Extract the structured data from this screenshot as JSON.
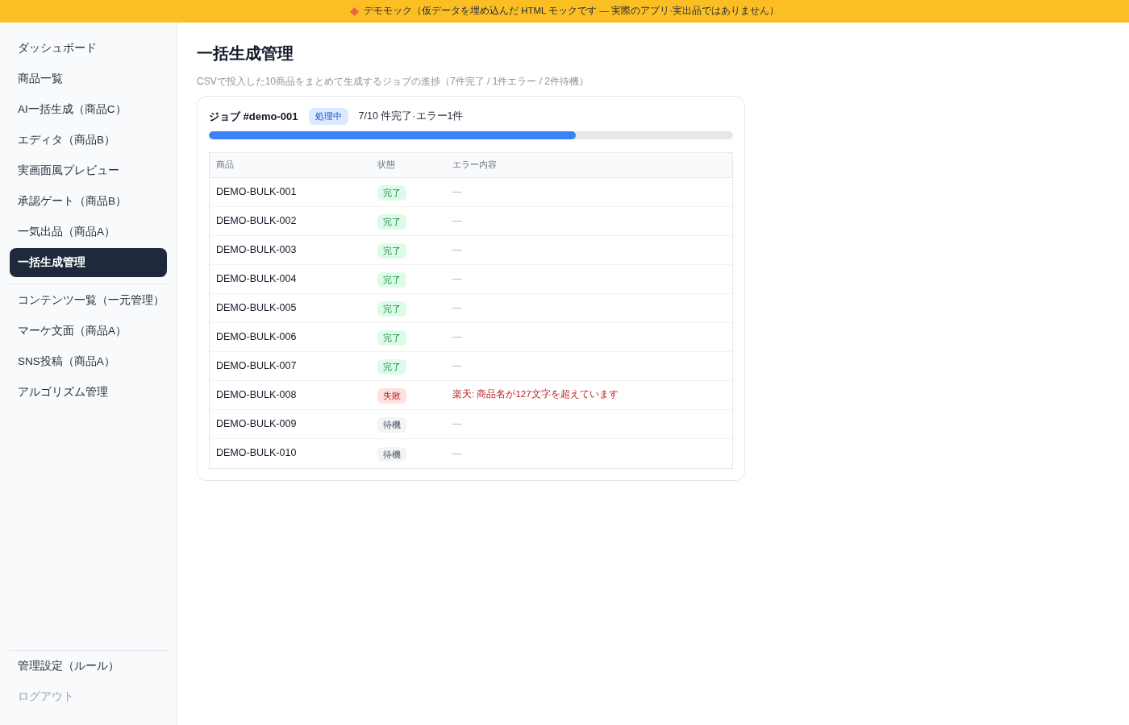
{
  "banner": {
    "text": "デモモック（仮データを埋め込んだ HTML モックです — 実際のアプリ·実出品ではありません）"
  },
  "sidebar": {
    "main_items": [
      {
        "label": "ダッシュボード",
        "selected": false
      },
      {
        "label": "商品一覧",
        "selected": false
      },
      {
        "label": "AI一括生成（商品C）",
        "selected": false
      },
      {
        "label": "エディタ（商品B）",
        "selected": false
      },
      {
        "label": "実画面風プレビュー",
        "selected": false
      },
      {
        "label": "承認ゲート（商品B）",
        "selected": false
      },
      {
        "label": "一気出品（商品A）",
        "selected": false
      },
      {
        "label": "一括生成管理",
        "selected": true
      }
    ],
    "secondary_items": [
      {
        "label": "コンテンツ一覧（一元管理）",
        "selected": false
      },
      {
        "label": "マーケ文面（商品A）",
        "selected": false
      },
      {
        "label": "SNS投稿（商品A）",
        "selected": false
      },
      {
        "label": "アルゴリズム管理",
        "selected": false
      }
    ],
    "footer_items": [
      {
        "label": "管理設定（ルール）",
        "kind": "link"
      },
      {
        "label": "ログアウト",
        "kind": "logout"
      }
    ]
  },
  "page": {
    "title": "一括生成管理",
    "subtitle": "CSVで投入した10商品をまとめて生成するジョブの進捗（7件完了 / 1件エラー / 2件待機）"
  },
  "job": {
    "title": "ジョブ #demo-001",
    "status": "処理中",
    "summary": "7/10 件完了·エラー1件",
    "progress": {
      "level": 0.7
    }
  },
  "table": {
    "columns": [
      "商品",
      "状態",
      "エラー内容"
    ],
    "rows": [
      {
        "product": "DEMO-BULK-001",
        "status": {
          "label": "完了",
          "kind": "done"
        },
        "error": "—"
      },
      {
        "product": "DEMO-BULK-002",
        "status": {
          "label": "完了",
          "kind": "done"
        },
        "error": "—"
      },
      {
        "product": "DEMO-BULK-003",
        "status": {
          "label": "完了",
          "kind": "done"
        },
        "error": "—"
      },
      {
        "product": "DEMO-BULK-004",
        "status": {
          "label": "完了",
          "kind": "done"
        },
        "error": "—"
      },
      {
        "product": "DEMO-BULK-005",
        "status": {
          "label": "完了",
          "kind": "done"
        },
        "error": "—"
      },
      {
        "product": "DEMO-BULK-006",
        "status": {
          "label": "完了",
          "kind": "done"
        },
        "error": "—"
      },
      {
        "product": "DEMO-BULK-007",
        "status": {
          "label": "完了",
          "kind": "done"
        },
        "error": "—"
      },
      {
        "product": "DEMO-BULK-008",
        "status": {
          "label": "失敗",
          "kind": "failed"
        },
        "error": "楽天: 商品名が127文字を超えています"
      },
      {
        "product": "DEMO-BULK-009",
        "status": {
          "label": "待機",
          "kind": "waiting"
        },
        "error": "—"
      },
      {
        "product": "DEMO-BULK-010",
        "status": {
          "label": "待機",
          "kind": "waiting"
        },
        "error": "—"
      }
    ]
  }
}
